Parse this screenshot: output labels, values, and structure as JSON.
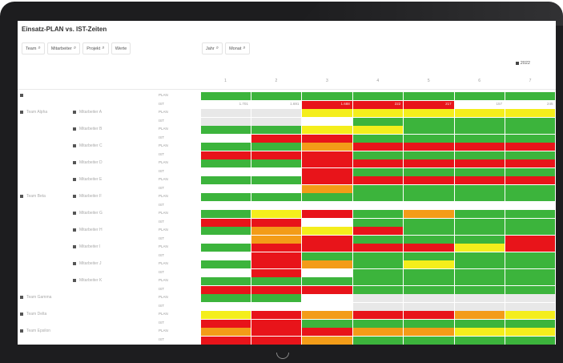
{
  "app": {
    "title": "Einsatz-PLAN vs. IST-Zeiten"
  },
  "filters_left": [
    {
      "label": "Team",
      "icon": "search-icon"
    },
    {
      "label": "Mitarbeiter",
      "icon": "search-icon"
    },
    {
      "label": "Projekt",
      "icon": "search-icon"
    },
    {
      "label": "Werte",
      "icon": ""
    }
  ],
  "filters_right": [
    {
      "label": "Jahr",
      "icon": "search-icon"
    },
    {
      "label": "Monat",
      "icon": "search-icon"
    }
  ],
  "year_badge": "2022",
  "column_headers": [
    "1",
    "2",
    "3",
    "4",
    "5",
    "6",
    "7"
  ],
  "colors": {
    "green": "#3cb43c",
    "red": "#e8141a",
    "yellow": "#f4ee1c",
    "orange": "#f39c18",
    "white": "#ffffff",
    "grey": "#e8e8e8"
  },
  "rows": [
    {
      "type": "PLAN",
      "cells": [
        "g",
        "g",
        "g",
        "g",
        "g",
        "g",
        "g"
      ]
    },
    {
      "type": "IST",
      "cells": [
        "w",
        "w",
        "r",
        "r",
        "r",
        "w",
        "w"
      ],
      "values": [
        "1.701",
        "1.691",
        "1.688",
        "222",
        "217",
        "157",
        "245"
      ]
    },
    {
      "type": "PLAN",
      "cells": [
        "x",
        "x",
        "y",
        "y",
        "y",
        "y",
        "y"
      ]
    },
    {
      "type": "IST",
      "cells": [
        "x",
        "x",
        "w",
        "g",
        "g",
        "g",
        "g"
      ]
    },
    {
      "type": "PLAN",
      "cells": [
        "g",
        "g",
        "y",
        "y",
        "g",
        "g",
        "g"
      ]
    },
    {
      "type": "IST",
      "cells": [
        "w",
        "r",
        "r",
        "g",
        "g",
        "g",
        "g"
      ]
    },
    {
      "type": "PLAN",
      "cells": [
        "g",
        "g",
        "o",
        "r",
        "r",
        "r",
        "r"
      ]
    },
    {
      "type": "IST",
      "cells": [
        "r",
        "r",
        "r",
        "g",
        "g",
        "g",
        "g"
      ]
    },
    {
      "type": "PLAN",
      "cells": [
        "g",
        "g",
        "r",
        "r",
        "r",
        "r",
        "r"
      ]
    },
    {
      "type": "IST",
      "cells": [
        "w",
        "w",
        "r",
        "g",
        "g",
        "g",
        "g"
      ]
    },
    {
      "type": "PLAN",
      "cells": [
        "g",
        "g",
        "r",
        "r",
        "r",
        "r",
        "r"
      ]
    },
    {
      "type": "IST",
      "cells": [
        "w",
        "w",
        "o",
        "g",
        "g",
        "g",
        "g"
      ]
    },
    {
      "type": "PLAN",
      "cells": [
        "g",
        "g",
        "g",
        "g",
        "g",
        "g",
        "g"
      ]
    },
    {
      "type": "IST",
      "cells": [
        "w",
        "w",
        "w",
        "w",
        "w",
        "w",
        "w"
      ]
    },
    {
      "type": "PLAN",
      "cells": [
        "g",
        "y",
        "r",
        "g",
        "o",
        "g",
        "g"
      ]
    },
    {
      "type": "IST",
      "cells": [
        "r",
        "r",
        "w",
        "g",
        "g",
        "g",
        "g"
      ]
    },
    {
      "type": "PLAN",
      "cells": [
        "g",
        "o",
        "y",
        "r",
        "g",
        "g",
        "g"
      ]
    },
    {
      "type": "IST",
      "cells": [
        "w",
        "o",
        "r",
        "g",
        "g",
        "g",
        "r"
      ]
    },
    {
      "type": "PLAN",
      "cells": [
        "g",
        "r",
        "r",
        "r",
        "r",
        "y",
        "r"
      ]
    },
    {
      "type": "IST",
      "cells": [
        "w",
        "r",
        "g",
        "g",
        "g",
        "g",
        "g"
      ]
    },
    {
      "type": "PLAN",
      "cells": [
        "g",
        "r",
        "o",
        "g",
        "y",
        "g",
        "g"
      ]
    },
    {
      "type": "IST",
      "cells": [
        "w",
        "r",
        "w",
        "g",
        "g",
        "g",
        "g"
      ]
    },
    {
      "type": "PLAN",
      "cells": [
        "g",
        "g",
        "g",
        "g",
        "g",
        "g",
        "g"
      ]
    },
    {
      "type": "IST",
      "cells": [
        "r",
        "r",
        "r",
        "g",
        "g",
        "g",
        "g"
      ]
    },
    {
      "type": "PLAN",
      "cells": [
        "g",
        "g",
        "w",
        "x",
        "x",
        "x",
        "x"
      ]
    },
    {
      "type": "IST",
      "cells": [
        "w",
        "w",
        "w",
        "x",
        "x",
        "x",
        "x"
      ]
    },
    {
      "type": "PLAN",
      "cells": [
        "y",
        "r",
        "o",
        "r",
        "r",
        "o",
        "y"
      ]
    },
    {
      "type": "IST",
      "cells": [
        "r",
        "r",
        "g",
        "g",
        "g",
        "g",
        "g"
      ]
    },
    {
      "type": "PLAN",
      "cells": [
        "o",
        "r",
        "r",
        "o",
        "o",
        "y",
        "y"
      ]
    },
    {
      "type": "IST",
      "cells": [
        "r",
        "r",
        "o",
        "g",
        "g",
        "g",
        "g"
      ]
    }
  ],
  "team_labels": [
    {
      "row": 0,
      "text": ""
    },
    {
      "row": 2,
      "text": "Team Alpha"
    },
    {
      "row": 12,
      "text": "Team Beta"
    },
    {
      "row": 24,
      "text": "Team Gamma"
    },
    {
      "row": 26,
      "text": "Team Delta"
    },
    {
      "row": 28,
      "text": "Team Epsilon"
    },
    {
      "row": 30,
      "text": "Team Zeta"
    }
  ],
  "person_labels": [
    {
      "row": 2,
      "text": "Mitarbeiter A"
    },
    {
      "row": 4,
      "text": "Mitarbeiter B"
    },
    {
      "row": 6,
      "text": "Mitarbeiter C"
    },
    {
      "row": 8,
      "text": "Mitarbeiter D"
    },
    {
      "row": 10,
      "text": "Mitarbeiter E"
    },
    {
      "row": 12,
      "text": "Mitarbeiter F"
    },
    {
      "row": 14,
      "text": "Mitarbeiter G"
    },
    {
      "row": 16,
      "text": "Mitarbeiter H"
    },
    {
      "row": 18,
      "text": "Mitarbeiter I"
    },
    {
      "row": 20,
      "text": "Mitarbeiter J"
    },
    {
      "row": 22,
      "text": "Mitarbeiter K"
    }
  ]
}
